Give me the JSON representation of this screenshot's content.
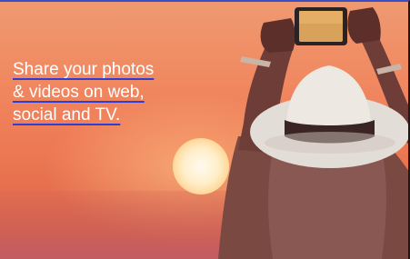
{
  "banner": {
    "headline_lines": [
      "Share your photos",
      "& videos on web,",
      "social and TV."
    ],
    "link_color": "#ffffff",
    "underline_color": "#2a3fd6"
  }
}
